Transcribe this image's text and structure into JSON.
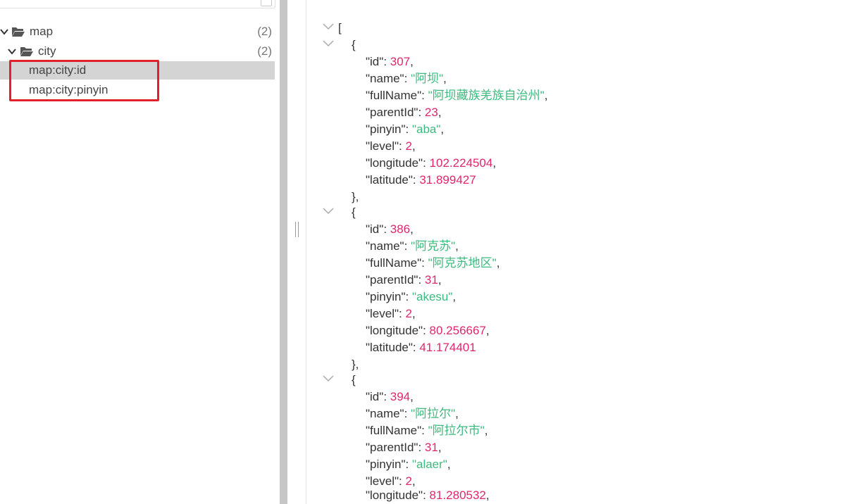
{
  "tree": {
    "nodes": [
      {
        "label": "map",
        "count": "(2)"
      },
      {
        "label": "city",
        "count": "(2)"
      },
      {
        "label": "map:city:id"
      },
      {
        "label": "map:city:pinyin"
      }
    ]
  },
  "json_viewer": {
    "open_bracket": "[",
    "open_brace": "{",
    "close_brace_comma": "},",
    "records": [
      {
        "id": "307",
        "name": "\"阿坝\"",
        "fullName": "\"阿坝藏族羌族自治州\"",
        "parentId": "23",
        "pinyin": "\"aba\"",
        "level": "2",
        "longitude": "102.224504",
        "latitude": "31.899427"
      },
      {
        "id": "386",
        "name": "\"阿克苏\"",
        "fullName": "\"阿克苏地区\"",
        "parentId": "31",
        "pinyin": "\"akesu\"",
        "level": "2",
        "longitude": "80.256667",
        "latitude": "41.174401"
      },
      {
        "id": "394",
        "name": "\"阿拉尔\"",
        "fullName": "\"阿拉尔市\"",
        "parentId": "31",
        "pinyin": "\"alaer\"",
        "level": "2",
        "longitude": "81.280532"
      }
    ],
    "keys": {
      "id": "\"id\"",
      "name": "\"name\"",
      "fullName": "\"fullName\"",
      "parentId": "\"parentId\"",
      "pinyin": "\"pinyin\"",
      "level": "\"level\"",
      "longitude": "\"longitude\"",
      "latitude": "\"latitude\""
    }
  }
}
